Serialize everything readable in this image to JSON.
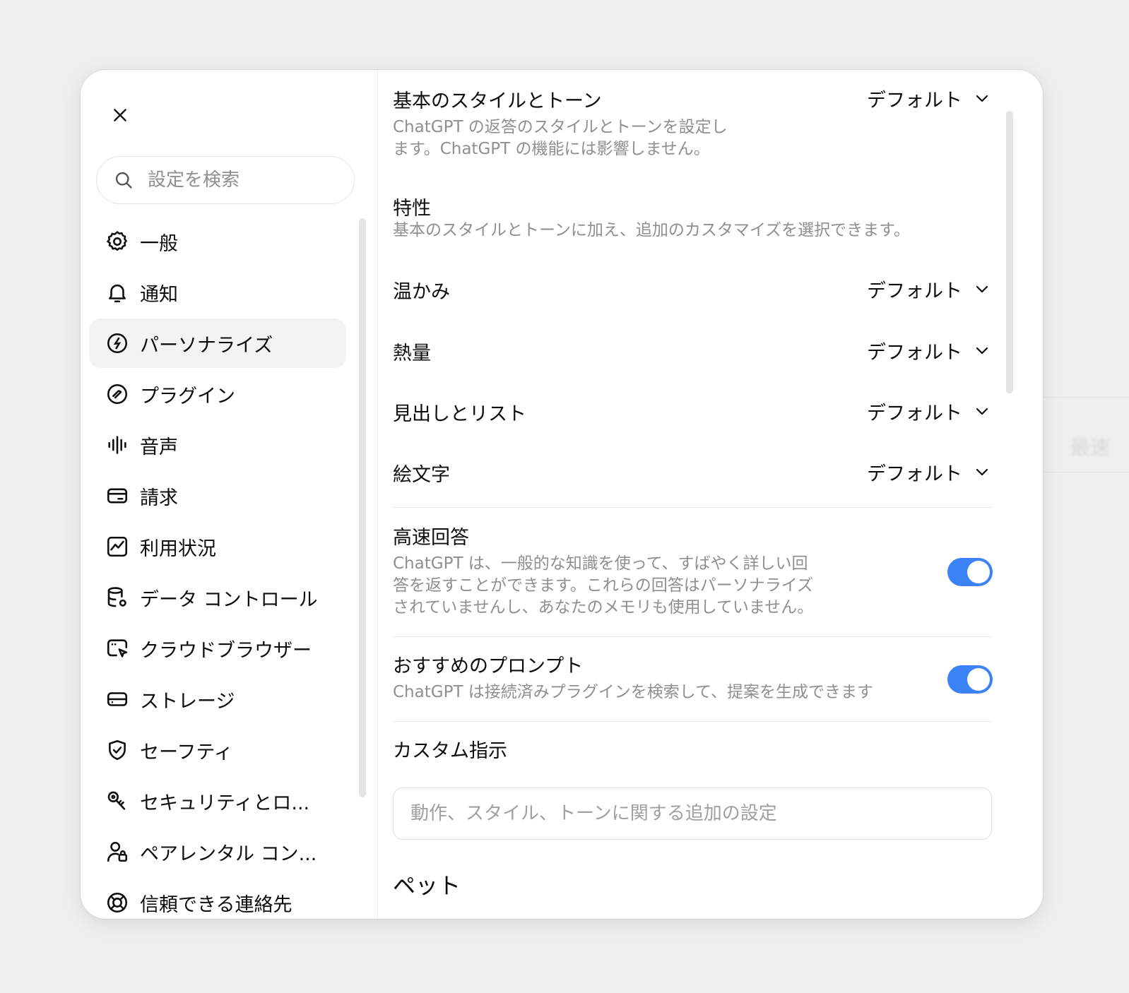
{
  "background": {
    "blurred_text": "最速"
  },
  "sidebar": {
    "search_placeholder": "設定を検索",
    "items": [
      {
        "label": "一般",
        "icon": "gear-icon",
        "active": false
      },
      {
        "label": "通知",
        "icon": "bell-icon",
        "active": false
      },
      {
        "label": "パーソナライズ",
        "icon": "personalize-icon",
        "active": true
      },
      {
        "label": "プラグイン",
        "icon": "plugin-icon",
        "active": false
      },
      {
        "label": "音声",
        "icon": "voice-wave-icon",
        "active": false
      },
      {
        "label": "請求",
        "icon": "card-icon",
        "active": false
      },
      {
        "label": "利用状況",
        "icon": "chart-icon",
        "active": false
      },
      {
        "label": "データ コントロール",
        "icon": "database-gear-icon",
        "active": false
      },
      {
        "label": "クラウドブラウザー",
        "icon": "browser-cursor-icon",
        "active": false
      },
      {
        "label": "ストレージ",
        "icon": "drive-icon",
        "active": false
      },
      {
        "label": "セーフティ",
        "icon": "shield-check-icon",
        "active": false
      },
      {
        "label": "セキュリティとロ...",
        "icon": "key-icon",
        "active": false
      },
      {
        "label": "ペアレンタル コン...",
        "icon": "user-lock-icon",
        "active": false
      },
      {
        "label": "信頼できる連絡先",
        "icon": "lifebuoy-icon",
        "active": false
      }
    ]
  },
  "main": {
    "base_style": {
      "title": "基本のスタイルとトーン",
      "description_line1": "ChatGPT の返答のスタイルとトーンを設定し",
      "description_line2": "ます。ChatGPT の機能には影響しません。",
      "value": "デフォルト"
    },
    "traits": {
      "title": "特性",
      "description": "基本のスタイルとトーンに加え、追加のカスタマイズを選択できます。",
      "items": [
        {
          "label": "温かみ",
          "value": "デフォルト"
        },
        {
          "label": "熱量",
          "value": "デフォルト"
        },
        {
          "label": "見出しとリスト",
          "value": "デフォルト"
        },
        {
          "label": "絵文字",
          "value": "デフォルト"
        }
      ]
    },
    "fast_answers": {
      "title": "高速回答",
      "description_line1": "ChatGPT は、一般的な知識を使って、すばやく詳しい回",
      "description_line2": "答を返すことができます。これらの回答はパーソナライズ",
      "description_line3": "されていませんし、あなたのメモリも使用していません。",
      "enabled": true,
      "accent_color": "#3b82f6"
    },
    "suggested_prompts": {
      "title": "おすすめのプロンプト",
      "description": "ChatGPT は接続済みプラグインを検索して、提案を生成できます",
      "enabled": true
    },
    "custom_instructions": {
      "title": "カスタム指示",
      "placeholder": "動作、スタイル、トーンに関する追加の設定"
    },
    "pets": {
      "title": "ペット"
    }
  }
}
